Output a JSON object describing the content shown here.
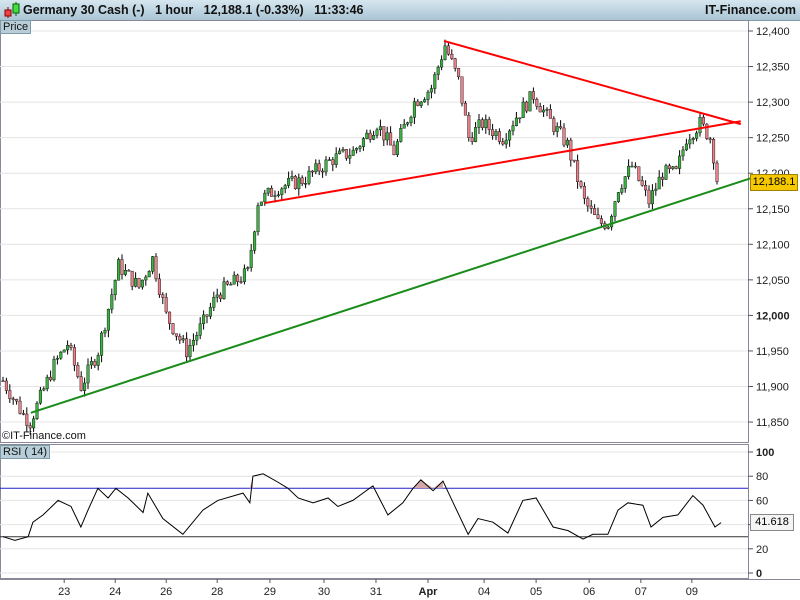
{
  "header": {
    "instrument": "Germany 30 Cash (-)",
    "timeframe": "1 hour",
    "last": "12,188.1",
    "change": "(-0.33%)",
    "time": "11:33:46",
    "brand": "IT-Finance.com"
  },
  "price_panel": {
    "label": "Price",
    "watermark": "©IT-Finance.com",
    "last_label": "12,188.1"
  },
  "rsi_panel": {
    "label": "RSI ( 14)",
    "last_label": "41.618"
  },
  "colors": {
    "up": "#3cb043",
    "down": "#e8808a",
    "resistance": "#ff0000",
    "support": "#1a8c1a",
    "rsi_band": "#2222cc",
    "last_bg": "#f5c800"
  },
  "chart_data": [
    {
      "type": "candlestick",
      "title": "Germany 30 Cash (-) 1 hour",
      "ylim": [
        11820,
        12420
      ],
      "yticks": [
        11850,
        11900,
        11950,
        12000,
        12050,
        12100,
        12150,
        12200,
        12250,
        12300,
        12350,
        12400
      ],
      "ytick_labels": [
        "11,850",
        "11,900",
        "11,950",
        "12,000",
        "12,050",
        "12,100",
        "12,150",
        "12,200",
        "12,250",
        "12,300",
        "12,350",
        "12,400"
      ],
      "x_labels": [
        {
          "bar": 18,
          "label": "23"
        },
        {
          "bar": 33,
          "label": "24"
        },
        {
          "bar": 48,
          "label": "26"
        },
        {
          "bar": 63,
          "label": "28"
        },
        {
          "bar": 78.5,
          "label": "29"
        },
        {
          "bar": 94.4,
          "label": "30"
        },
        {
          "bar": 109.7,
          "label": "31"
        },
        {
          "bar": 125,
          "label": "Apr"
        },
        {
          "bar": 141.5,
          "label": "04"
        },
        {
          "bar": 156.8,
          "label": "05"
        },
        {
          "bar": 172.4,
          "label": "06"
        },
        {
          "bar": 187.6,
          "label": "07"
        },
        {
          "bar": 202.6,
          "label": "09"
        }
      ],
      "close_path": [
        [
          1,
          11900
        ],
        [
          6,
          11860
        ],
        [
          8,
          11850
        ],
        [
          15,
          11930
        ],
        [
          19,
          11960
        ],
        [
          23,
          11900
        ],
        [
          28,
          11950
        ],
        [
          34,
          12070
        ],
        [
          40,
          12040
        ],
        [
          44,
          12080
        ],
        [
          48,
          12000
        ],
        [
          54,
          11950
        ],
        [
          59,
          11990
        ],
        [
          63,
          12030
        ],
        [
          72,
          12060
        ],
        [
          75,
          12160
        ],
        [
          81,
          12180
        ],
        [
          88,
          12190
        ],
        [
          97,
          12220
        ],
        [
          103,
          12230
        ],
        [
          110,
          12270
        ],
        [
          115,
          12230
        ],
        [
          121,
          12300
        ],
        [
          126,
          12320
        ],
        [
          130,
          12380
        ],
        [
          134,
          12330
        ],
        [
          137,
          12250
        ],
        [
          141,
          12270
        ],
        [
          147,
          12250
        ],
        [
          151,
          12280
        ],
        [
          156,
          12310
        ],
        [
          160,
          12280
        ],
        [
          166,
          12240
        ],
        [
          171,
          12160
        ],
        [
          175,
          12130
        ],
        [
          178,
          12130
        ],
        [
          181,
          12180
        ],
        [
          185,
          12210
        ],
        [
          190,
          12160
        ],
        [
          194,
          12200
        ],
        [
          198,
          12200
        ],
        [
          201,
          12250
        ],
        [
          205,
          12270
        ],
        [
          208,
          12250
        ],
        [
          210.5,
          12188.1
        ]
      ],
      "trendlines": [
        {
          "name": "resistance-descending",
          "color": "#ff0000",
          "from": [
            129.7,
            12386
          ],
          "to": [
            217,
            12269
          ]
        },
        {
          "name": "resistance-ascending",
          "color": "#ff0000",
          "from": [
            77,
            12158
          ],
          "to": [
            217,
            12273
          ]
        },
        {
          "name": "support-ascending",
          "color": "#1a8c1a",
          "from": [
            8.2,
            11863
          ],
          "to": [
            220,
            12193
          ]
        }
      ],
      "last": 12188.1
    },
    {
      "type": "line",
      "title": "RSI ( 14)",
      "ylim": [
        0,
        100
      ],
      "yticks": [
        0,
        20,
        40,
        60,
        80,
        100
      ],
      "ytick_labels": [
        "0",
        "20",
        "40",
        "60",
        "80",
        "100"
      ],
      "bands": [
        30,
        70
      ],
      "x": [
        0,
        3.5,
        7.4,
        8.8,
        11.8,
        16.2,
        20,
        22.9,
        25,
        27.9,
        30.9,
        33.2,
        36.8,
        41.2,
        42.6,
        47,
        52.9,
        58.8,
        63.2,
        70.6,
        72.6,
        73.5,
        76.5,
        80.9,
        83.8,
        86.8,
        91.2,
        95.6,
        98.5,
        102.9,
        108.8,
        113.2,
        117.6,
        120.6,
        122.9,
        126.5,
        129.4,
        132.4,
        136.8,
        139.7,
        144.1,
        148.5,
        152.9,
        156.8,
        161.8,
        166.2,
        170.6,
        173.5,
        177.9,
        180.9,
        183.8,
        188.2,
        190.6,
        194.1,
        198.5,
        202.9,
        205.9,
        209.4,
        211.2
      ],
      "values": [
        30,
        27,
        30,
        42,
        48,
        60,
        55,
        38,
        52,
        70,
        62,
        70,
        62,
        50,
        66,
        45,
        32,
        52,
        60,
        66,
        58,
        80,
        82,
        75,
        70,
        62,
        58,
        62,
        55,
        60,
        72,
        48,
        58,
        70,
        77,
        68,
        76,
        58,
        32,
        45,
        42,
        33,
        60,
        62,
        38,
        35,
        28,
        32,
        32,
        52,
        58,
        56,
        38,
        46,
        48,
        64,
        56,
        38,
        41.618
      ]
    }
  ]
}
